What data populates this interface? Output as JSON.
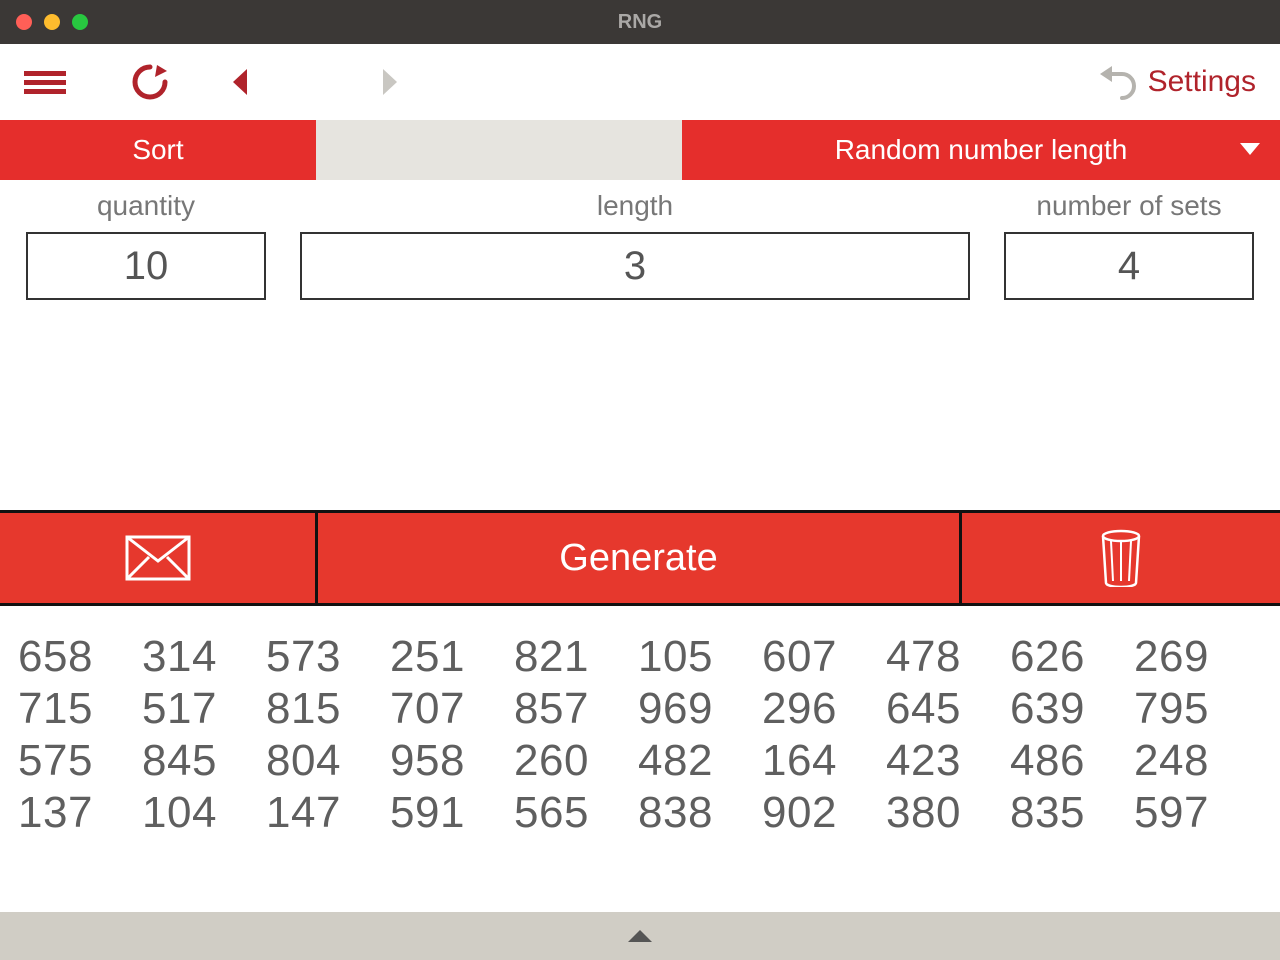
{
  "window": {
    "title": "RNG"
  },
  "toolbar": {
    "settings_label": "Settings"
  },
  "tabs": {
    "sort_label": "Sort",
    "rnl_label": "Random number length"
  },
  "fields": {
    "quantity": {
      "label": "quantity",
      "value": "10"
    },
    "length": {
      "label": "length",
      "value": "3"
    },
    "sets": {
      "label": "number of sets",
      "value": "4"
    }
  },
  "actions": {
    "generate_label": "Generate"
  },
  "results": [
    [
      "658",
      "314",
      "573",
      "251",
      "821",
      "105",
      "607",
      "478",
      "626",
      "269"
    ],
    [
      "715",
      "517",
      "815",
      "707",
      "857",
      "969",
      "296",
      "645",
      "639",
      "795"
    ],
    [
      "575",
      "845",
      "804",
      "958",
      "260",
      "482",
      "164",
      "423",
      "486",
      "248"
    ],
    [
      "137",
      "104",
      "147",
      "591",
      "565",
      "838",
      "902",
      "380",
      "835",
      "597"
    ]
  ],
  "colors": {
    "accent": "#e6382d",
    "accent_dark": "#b0232b",
    "tab_red": "#e52e2c"
  }
}
